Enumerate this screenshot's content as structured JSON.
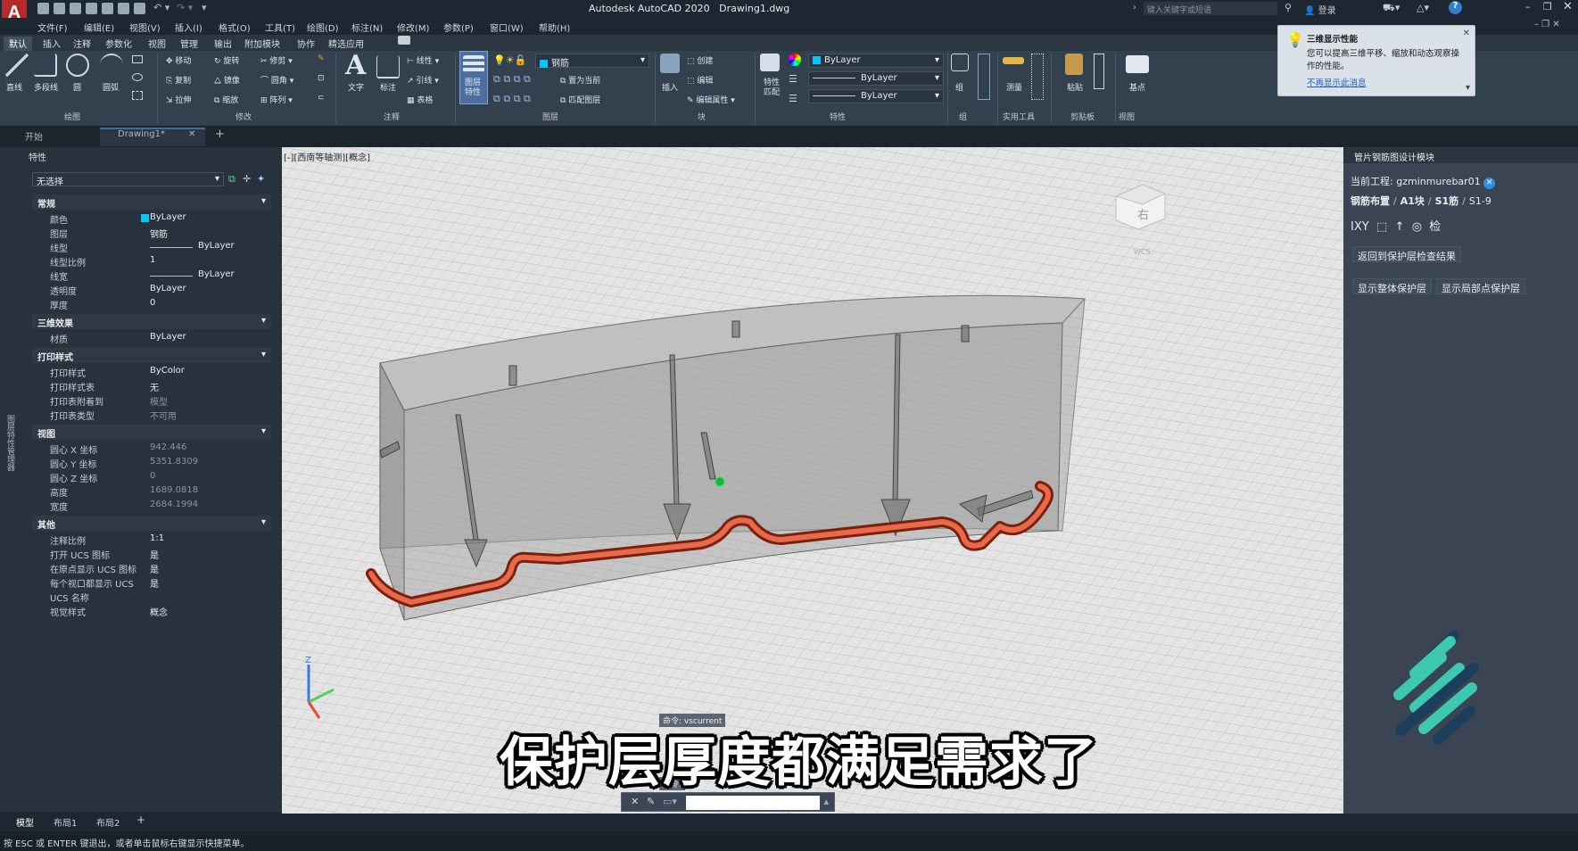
{
  "app": {
    "title": "Autodesk AutoCAD 2020",
    "filename": "Drawing1.dwg",
    "logo": "A",
    "search_placeholder": "键入关键字或短语",
    "login": "登录"
  },
  "menubar": [
    "文件(F)",
    "编辑(E)",
    "视图(V)",
    "插入(I)",
    "格式(O)",
    "工具(T)",
    "绘图(D)",
    "标注(N)",
    "修改(M)",
    "参数(P)",
    "窗口(W)",
    "帮助(H)"
  ],
  "ribbon_tabs": [
    "默认",
    "插入",
    "注释",
    "参数化",
    "视图",
    "管理",
    "输出",
    "附加模块",
    "协作",
    "精选应用"
  ],
  "ribbon": {
    "draw": {
      "line": "直线",
      "polyline": "多段线",
      "circle": "圆",
      "arc": "圆弧",
      "panel": "绘图"
    },
    "modify": {
      "move": "移动",
      "rotate": "旋转",
      "trim": "修剪",
      "copy": "复制",
      "mirror": "镜像",
      "fillet": "圆角",
      "stretch": "拉伸",
      "scale": "缩放",
      "array": "阵列",
      "panel": "修改"
    },
    "annotation": {
      "text": "文字",
      "dimension": "标注",
      "linear": "线性",
      "leader": "引线",
      "table": "表格",
      "panel": "注释"
    },
    "layers": {
      "layer_props": "图层特性",
      "layer_name": "钢筋",
      "set_current": "置为当前",
      "match_layer": "匹配图层",
      "panel": "图层"
    },
    "block": {
      "insert": "插入",
      "create": "创建",
      "edit": "编辑",
      "edit_attr": "编辑属性",
      "panel": "块"
    },
    "properties": {
      "match": "特性匹配",
      "color": "ByLayer",
      "linetype": "ByLayer",
      "lineweight": "ByLayer",
      "panel": "特性"
    },
    "groups": {
      "group": "组",
      "panel": "组"
    },
    "utilities": {
      "measure": "测量",
      "panel": "实用工具"
    },
    "clipboard": {
      "paste": "粘贴",
      "panel": "剪贴板"
    },
    "view": {
      "base": "基点",
      "panel": "视图"
    }
  },
  "tooltip": {
    "title": "三维显示性能",
    "body": "您可以提高三维平移、缩放和动态观察操作的性能。",
    "link": "不再显示此消息"
  },
  "doc_tabs": {
    "start": "开始",
    "drawing": "Drawing1*",
    "add": "+"
  },
  "properties_panel": {
    "title": "特性",
    "selection": "无选择",
    "side_label": "图层特性管理器",
    "sections": [
      {
        "name": "常规",
        "rows": [
          {
            "k": "颜色",
            "v": "ByLayer"
          },
          {
            "k": "图层",
            "v": "钢筋"
          },
          {
            "k": "线型",
            "v": "ByLayer"
          },
          {
            "k": "线型比例",
            "v": "1"
          },
          {
            "k": "线宽",
            "v": "ByLayer"
          },
          {
            "k": "透明度",
            "v": "ByLayer"
          },
          {
            "k": "厚度",
            "v": "0"
          }
        ]
      },
      {
        "name": "三维效果",
        "rows": [
          {
            "k": "材质",
            "v": "ByLayer"
          }
        ]
      },
      {
        "name": "打印样式",
        "rows": [
          {
            "k": "打印样式",
            "v": "ByColor"
          },
          {
            "k": "打印样式表",
            "v": "无"
          },
          {
            "k": "打印表附着到",
            "v": "模型"
          },
          {
            "k": "打印表类型",
            "v": "不可用"
          }
        ]
      },
      {
        "name": "视图",
        "rows": [
          {
            "k": "圆心 X 坐标",
            "v": "942.446"
          },
          {
            "k": "圆心 Y 坐标",
            "v": "5351.8309"
          },
          {
            "k": "圆心 Z 坐标",
            "v": "0"
          },
          {
            "k": "高度",
            "v": "1689.0818"
          },
          {
            "k": "宽度",
            "v": "2684.1994"
          }
        ]
      },
      {
        "name": "其他",
        "rows": [
          {
            "k": "注释比例",
            "v": "1:1"
          },
          {
            "k": "打开 UCS 图标",
            "v": "是"
          },
          {
            "k": "在原点显示 UCS 图标",
            "v": "是"
          },
          {
            "k": "每个视口都显示 UCS",
            "v": "是"
          },
          {
            "k": "UCS 名称",
            "v": ""
          },
          {
            "k": "视觉样式",
            "v": "概念"
          }
        ]
      }
    ]
  },
  "viewport": {
    "label": "[-][西南等轴测][概念]",
    "viewcube_face": "右",
    "wcs": "WCS",
    "subtitle": "保护层厚度都满足需求了",
    "cmd_history_1": "命令: vscurrent",
    "cmd_history_2": "命令:",
    "cmd_prompt": ""
  },
  "right_panel": {
    "title": "管片钢筋图设计模块",
    "project_label": "当前工程:",
    "project_name": "gzminmurebar01",
    "breadcrumb": [
      "钢筋布置",
      "A1块",
      "S1筋",
      "S1-9"
    ],
    "tool_icons": [
      "IXY",
      "块",
      "↑",
      "◎",
      "检"
    ],
    "btn_return": "返回到保护层检查结果",
    "btn_overall": "显示整体保护层",
    "btn_local": "显示局部点保护层"
  },
  "layout_tabs": [
    "模型",
    "布局1",
    "布局2",
    "+"
  ],
  "status": "按 ESC 或 ENTER 键退出，或者单击鼠标右键显示快捷菜单。",
  "colors": {
    "accent": "#00c8ff",
    "rebar": "#e05a3a",
    "logo": "#b42a2a",
    "teal": "#3fc8b0"
  }
}
